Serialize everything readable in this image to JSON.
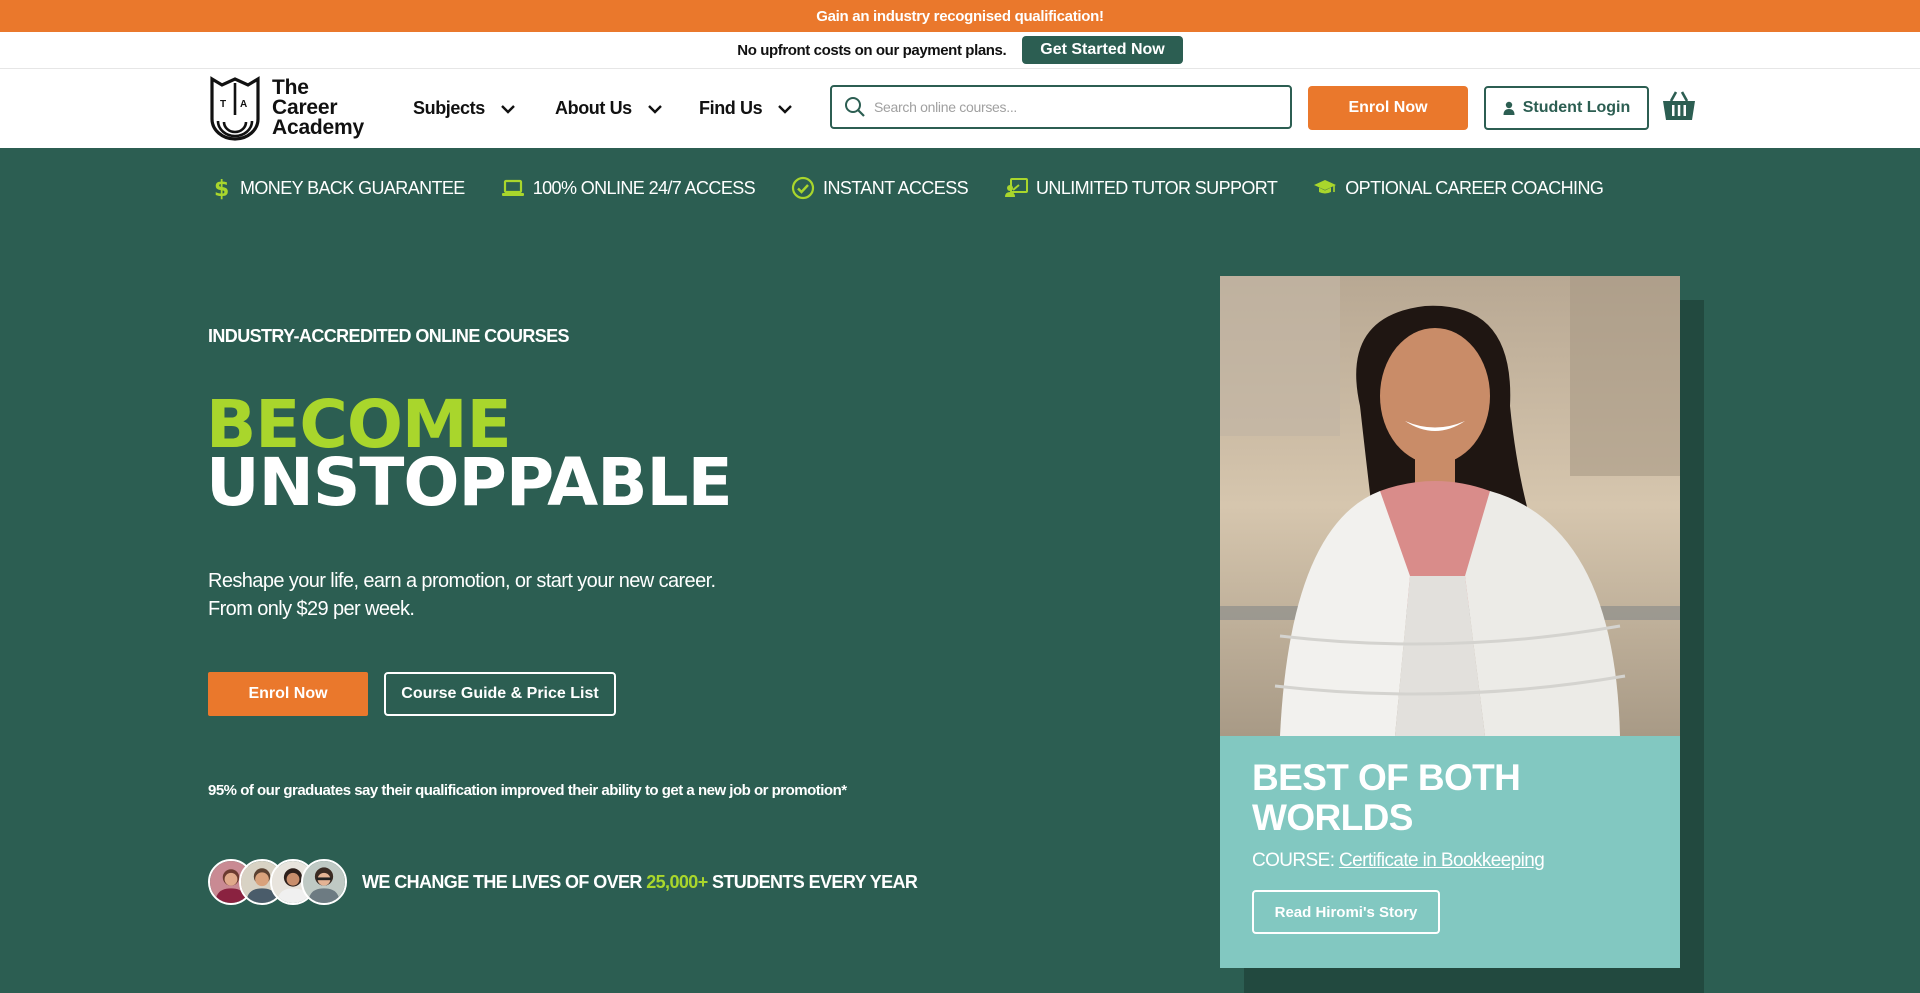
{
  "promo": {
    "text": "Gain an industry recognised qualification!"
  },
  "plan": {
    "text": "No upfront costs on our payment plans.",
    "cta": "Get Started Now"
  },
  "header": {
    "logo": {
      "line1": "The",
      "line2": "Career",
      "line3": "Academy"
    },
    "nav": [
      {
        "label": "Subjects"
      },
      {
        "label": "About Us"
      },
      {
        "label": "Find Us"
      }
    ],
    "search": {
      "placeholder": "Search online courses...",
      "value": ""
    },
    "enrol_label": "Enrol Now",
    "login_label": "Student Login"
  },
  "usps": [
    {
      "icon": "dollar-icon",
      "label": "MONEY BACK GUARANTEE"
    },
    {
      "icon": "laptop-icon",
      "label": "100% ONLINE 24/7 ACCESS"
    },
    {
      "icon": "check-circle-icon",
      "label": "INSTANT ACCESS"
    },
    {
      "icon": "tutor-icon",
      "label": "UNLIMITED TUTOR SUPPORT"
    },
    {
      "icon": "graduation-cap-icon",
      "label": "OPTIONAL CAREER COACHING"
    }
  ],
  "hero": {
    "eyebrow": "INDUSTRY-ACCREDITED ONLINE COURSES",
    "headline_1": "BECOME",
    "headline_2": "UNSTOPPABLE",
    "sub_1": "Reshape your life, earn a promotion, or start your new career.",
    "sub_2": "From only $29 per week.",
    "enrol_label": "Enrol Now",
    "guide_label": "Course Guide & Price List",
    "stat": "95% of our graduates say their qualification improved their ability to get a new job or promotion*",
    "lives_pre": "WE CHANGE THE LIVES OF OVER ",
    "lives_num": "25,000+",
    "lives_post": " STUDENTS EVERY YEAR"
  },
  "story": {
    "title_1": "BEST OF BOTH",
    "title_2": "WORLDS",
    "course_prefix": "COURSE: ",
    "course_link": "Certificate in Bookkeeping",
    "button": "Read Hiromi's Story"
  },
  "colors": {
    "brand_green": "#2c5e52",
    "accent_orange": "#ea782c",
    "accent_lime": "#a9d62c",
    "card_teal": "#82c8c1"
  }
}
